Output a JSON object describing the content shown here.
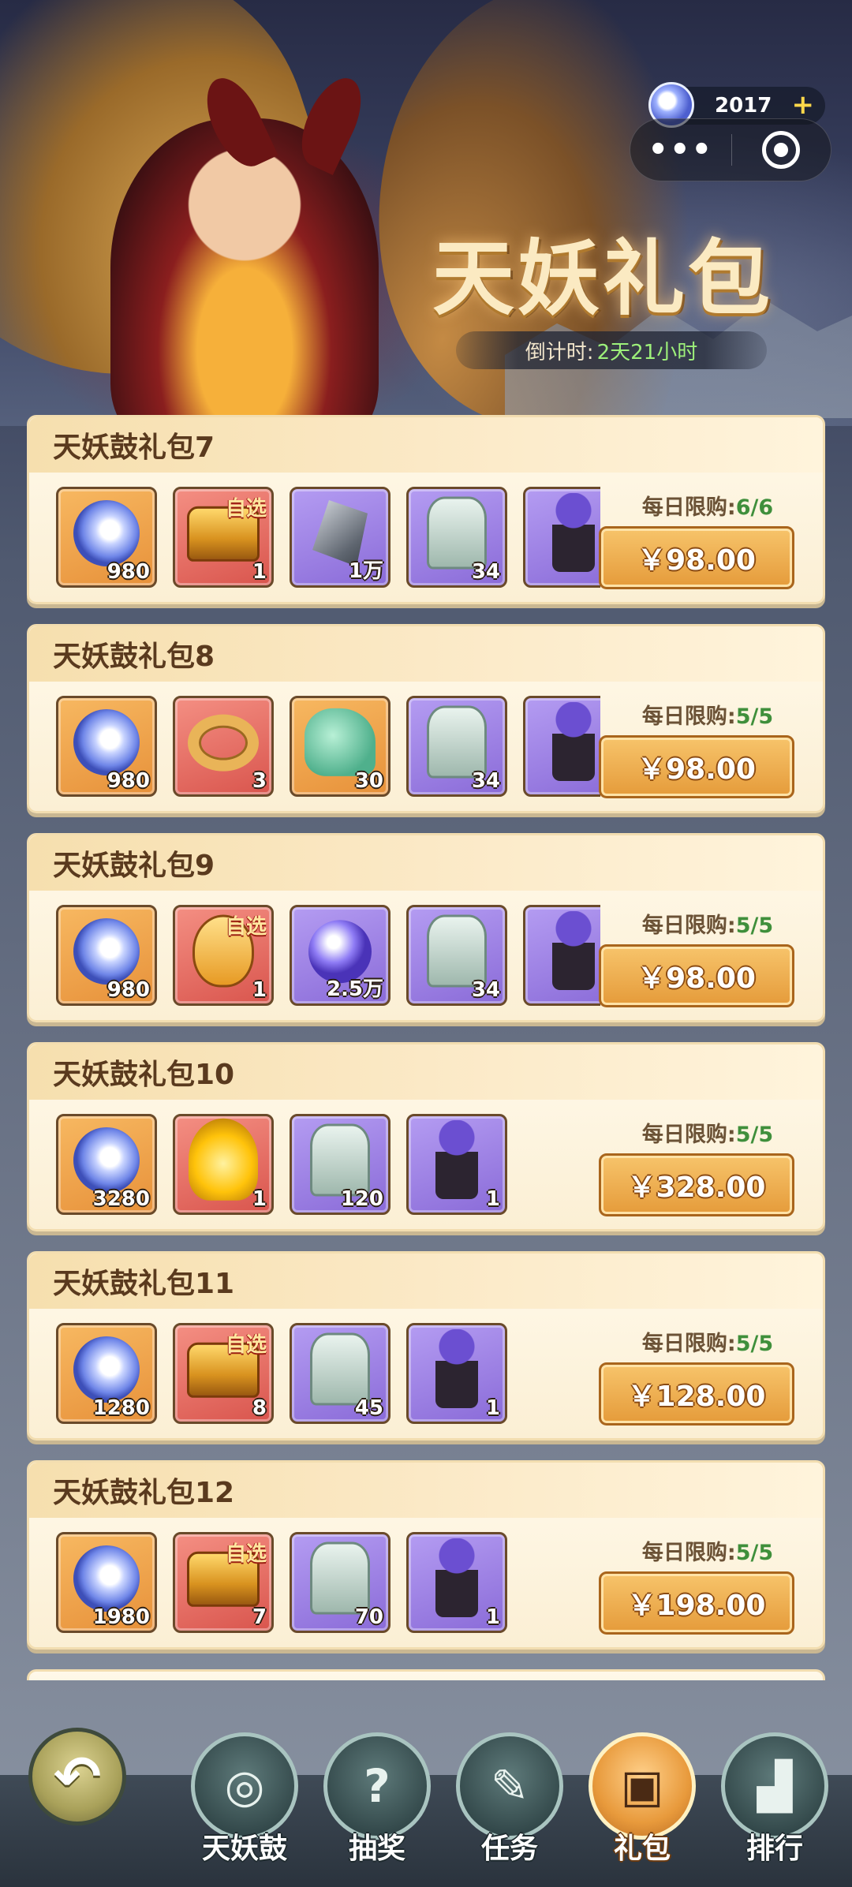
{
  "header": {
    "title": "天妖礼包",
    "countdown_label": "倒计时:",
    "countdown_value": "2天21小时",
    "currency_amount": "2017",
    "menu_dots": "•••"
  },
  "packs": [
    {
      "name": "天妖鼓礼包7",
      "limit_label": "每日限购:",
      "limit_value": "6/6",
      "price": "￥98.00",
      "items": [
        {
          "icon": "blue-gem-icon",
          "qty": "980"
        },
        {
          "icon": "optional-treasure-chest-icon",
          "qty": "1",
          "tag": "自选"
        },
        {
          "icon": "iron-ore-icon",
          "qty": "1万"
        },
        {
          "icon": "jade-token-icon",
          "qty": "34"
        },
        {
          "icon": "pawn-piece-icon",
          "qty": ""
        }
      ]
    },
    {
      "name": "天妖鼓礼包8",
      "limit_label": "每日限购:",
      "limit_value": "5/5",
      "price": "￥98.00",
      "items": [
        {
          "icon": "blue-gem-icon",
          "qty": "980"
        },
        {
          "icon": "gold-ring-icon",
          "qty": "3"
        },
        {
          "icon": "jade-lion-icon",
          "qty": "30"
        },
        {
          "icon": "jade-token-icon",
          "qty": "34"
        },
        {
          "icon": "pawn-piece-icon",
          "qty": ""
        }
      ]
    },
    {
      "name": "天妖鼓礼包9",
      "limit_label": "每日限购:",
      "limit_value": "5/5",
      "price": "￥98.00",
      "items": [
        {
          "icon": "blue-gem-icon",
          "qty": "980"
        },
        {
          "icon": "optional-egg-icon",
          "qty": "1",
          "tag": "自选"
        },
        {
          "icon": "purple-orb-icon",
          "qty": "2.5万"
        },
        {
          "icon": "jade-token-icon",
          "qty": "34"
        },
        {
          "icon": "pawn-piece-icon",
          "qty": ""
        }
      ]
    },
    {
      "name": "天妖鼓礼包10",
      "limit_label": "每日限购:",
      "limit_value": "5/5",
      "price": "￥328.00",
      "items": [
        {
          "icon": "blue-gem-icon",
          "qty": "3280"
        },
        {
          "icon": "golden-flame-hero-icon",
          "qty": "1"
        },
        {
          "icon": "jade-token-icon",
          "qty": "120"
        },
        {
          "icon": "pawn-piece-icon",
          "qty": "1"
        }
      ]
    },
    {
      "name": "天妖鼓礼包11",
      "limit_label": "每日限购:",
      "limit_value": "5/5",
      "price": "￥128.00",
      "items": [
        {
          "icon": "blue-gem-icon",
          "qty": "1280"
        },
        {
          "icon": "optional-treasure-chest-icon",
          "qty": "8",
          "tag": "自选"
        },
        {
          "icon": "jade-token-icon",
          "qty": "45"
        },
        {
          "icon": "pawn-piece-icon",
          "qty": "1"
        }
      ]
    },
    {
      "name": "天妖鼓礼包12",
      "limit_label": "每日限购:",
      "limit_value": "5/5",
      "price": "￥198.00",
      "items": [
        {
          "icon": "blue-gem-icon",
          "qty": "1980"
        },
        {
          "icon": "optional-treasure-chest-icon",
          "qty": "7",
          "tag": "自选"
        },
        {
          "icon": "jade-token-icon",
          "qty": "70"
        },
        {
          "icon": "pawn-piece-icon",
          "qty": "1"
        }
      ]
    }
  ],
  "nav": {
    "back_icon": "back-arrow-icon",
    "tabs": [
      {
        "label": "天妖鼓",
        "icon": "drum-icon",
        "active": false
      },
      {
        "label": "抽奖",
        "icon": "lottery-card-icon",
        "active": false
      },
      {
        "label": "任务",
        "icon": "scroll-icon",
        "active": false
      },
      {
        "label": "礼包",
        "icon": "gift-chest-icon",
        "active": true
      },
      {
        "label": "排行",
        "icon": "ranking-podium-icon",
        "active": false
      }
    ]
  },
  "colors": {
    "accent_orange": "#e59b3a",
    "limit_green": "#3f8f3b",
    "card_bg": "#fff9ea",
    "countdown_green": "#9df07a"
  }
}
